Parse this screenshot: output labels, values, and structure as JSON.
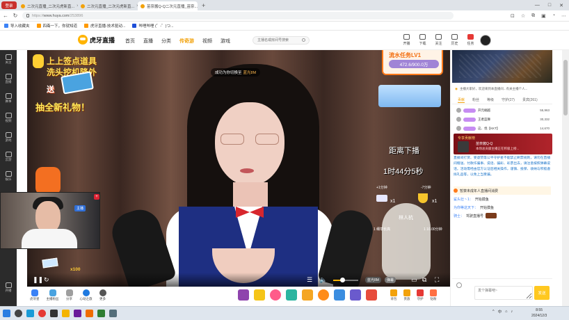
{
  "browser": {
    "window_button": "登录",
    "tabs": [
      {
        "title": "二次元直播_二次元虎新直...",
        "active": false
      },
      {
        "title": "二次元直播_二次元虎新直...",
        "active": false
      },
      {
        "title": "苗奈酱Q-Q二次元直播_苗奈...",
        "active": true
      }
    ],
    "url": "https://www.huya.com/253896",
    "url_prefix": "https://",
    "url_host": "www.huya.com",
    "url_path": "/253896",
    "bookmarks": [
      "导入收藏夹",
      "四斋一下，你就知道",
      "虎牙直播-技术驱动...",
      "哔哩哔哩 (゜-゜)つ..."
    ]
  },
  "site": {
    "logo": "虎牙直播",
    "nav": [
      "首页",
      "直播",
      "分类",
      "传奇游",
      "视频",
      "游戏"
    ],
    "nav_highlight_index": 3,
    "search_placeholder": "主播名或房间号搜索",
    "tools": [
      "开播",
      "下载",
      "关注",
      "历史",
      "任务"
    ]
  },
  "sidebar": [
    "关注",
    "直播",
    "赛事",
    "视频",
    "游戏",
    "云游",
    "娱乐",
    "开播"
  ],
  "player": {
    "promo_line1": "上上签点道具",
    "promo_line2": "洗头挖机降外",
    "promo_send": "送",
    "promo_bottom": "抽全新礼物！",
    "toast_prefix": "成功为你切换至",
    "toast_quality": "蓝光8M",
    "task_title": "流水任务LV1",
    "task_value": "472.6/900.0万",
    "countdown_title": "距离下播",
    "countdown_time": "1时44分5秒",
    "score_left": "+1分钟",
    "score_right": "-7分钟",
    "x_left": "x1",
    "x_right": "x1",
    "name_right": "林人杭",
    "sub_left": "1 细草长高",
    "sub_right": "1 10.00分钟",
    "rocket_text": "x100",
    "controls": {
      "quality": "蓝光8M",
      "mode": "弹幕",
      "volume_fraction": 0.35
    }
  },
  "webcam": {
    "tag": "主播"
  },
  "giftbar": {
    "left": [
      "虎牙星",
      "主播粉丝",
      "分享",
      "心动之旅",
      "更多"
    ],
    "right": [
      "背包",
      "贵族",
      "守护",
      "钻粉"
    ]
  },
  "right_panel": {
    "announcement": "主播大家好，欢迎来到本直播间...有关主播个人...",
    "tabs": [
      "贡献",
      "粉丝",
      "等级",
      "守护(27)",
      "贵宾(261)"
    ],
    "ranks": [
      {
        "name": "开元崛越",
        "value": "55,963"
      },
      {
        "name": "王者蓝狮",
        "value": "30,332"
      },
      {
        "name": "这、伐【KKT】",
        "value": "14,670"
      }
    ],
    "guard_card": {
      "title": "专享贡献榜",
      "name": "苗奈酱Q-Q",
      "desc": "本场总贡献主播正在积极上榜..."
    },
    "notice": "直播间打赏、受虐赞等公平守护星不能禁止刷票规则，请勿在直播间赠送、付款诈骗事、说话、骗彩、彩票出去，请注意按照弹幕说话，活动需经由官方认证后相关操作，谨慎、投保、收纳与积极虚拟礼品等，以免上当受骗。",
    "chat": [
      {
        "user": "",
        "text": "暂禁未成年人直播间消费",
        "system": true
      },
      {
        "user": "鲨头壮丶1：",
        "text": "开始摸鱼",
        "system": false
      },
      {
        "user": "为你等这天下：",
        "text": "开始摸鱼",
        "system": false
      },
      {
        "user": "骑士：",
        "text": "驾驶直播号",
        "system": false
      }
    ],
    "input_placeholder": "发个弹幕吧~",
    "send_label": "发送"
  },
  "taskbar": {
    "tray": "中",
    "time": "8:55",
    "date": "2024/12/3"
  }
}
